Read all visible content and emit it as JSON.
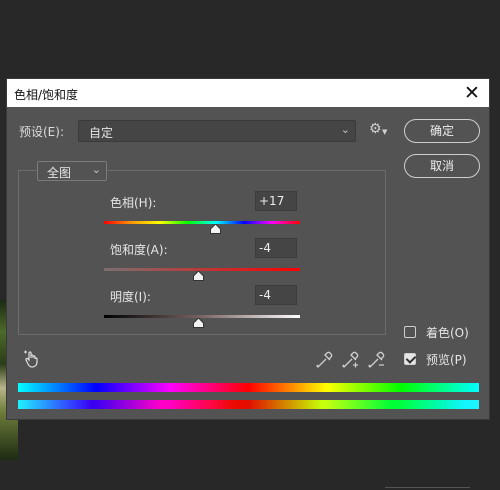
{
  "dialog": {
    "title": "色相/饱和度",
    "close_glyph": "✕"
  },
  "preset": {
    "label": "预设(E):",
    "value": "自定"
  },
  "buttons": {
    "ok": "确定",
    "cancel": "取消"
  },
  "channel": {
    "value": "全图"
  },
  "sliders": {
    "hue": {
      "label": "色相(H):",
      "value": "+17",
      "fraction": 0.57
    },
    "saturation": {
      "label": "饱和度(A):",
      "value": "-4",
      "fraction": 0.48
    },
    "lightness": {
      "label": "明度(I):",
      "value": "-4",
      "fraction": 0.48
    }
  },
  "options": {
    "colorize": {
      "label": "着色(O)",
      "checked": false
    },
    "preview": {
      "label": "预览(P)",
      "checked": true
    }
  },
  "icons": [
    "close-icon",
    "gear-icon",
    "chevron-down-icon",
    "hand-adjust-icon",
    "eyedropper-icon",
    "eyedropper-add-icon",
    "eyedropper-subtract-icon"
  ]
}
